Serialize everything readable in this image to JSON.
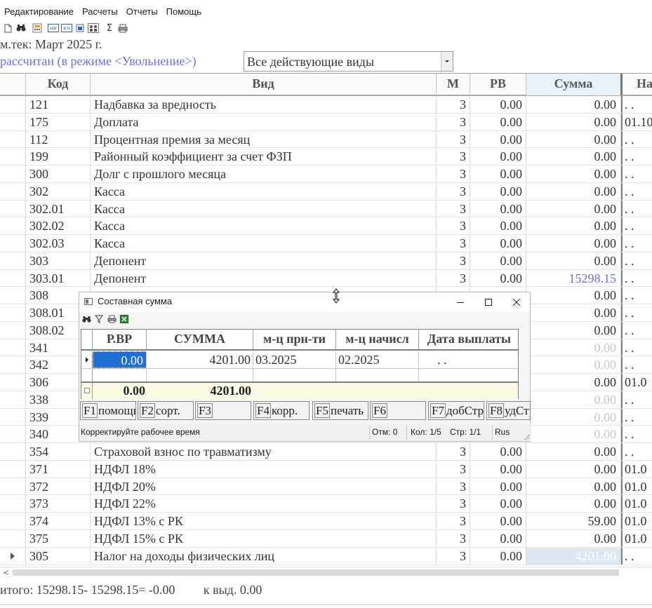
{
  "menu": [
    "Редактирование",
    "Расчеты",
    "Отчеты",
    "Помощь"
  ],
  "toolbar_icons": [
    "new-document-icon",
    "find-icon",
    "calculator-icon",
    "nu-icon",
    "kch-icon",
    "window-icon",
    "users-icon",
    "sigma-icon",
    "print-icon"
  ],
  "toolbar_labels": {
    "nu": "НУ",
    "kch": "КЧ",
    "sigma": "Σ"
  },
  "header": {
    "period": "м.тек: Март 2025 г.",
    "status": "рассчитан (в режиме <Увольнение>)",
    "filter_value": "Все действующие виды"
  },
  "grid": {
    "columns": [
      "Код",
      "Вид",
      "М",
      "РВ",
      "Сумма",
      "На"
    ],
    "rows": [
      {
        "code": "121",
        "vid": "Надбавка за вредность",
        "m": "3",
        "rv": "0.00",
        "sum": "0.00",
        "na": ". ."
      },
      {
        "code": "175",
        "vid": "Доплата",
        "m": "3",
        "rv": "0.00",
        "sum": "0.00",
        "na": "01.10"
      },
      {
        "code": "112",
        "vid": "Процентная премия за месяц",
        "m": "3",
        "rv": "0.00",
        "sum": "0.00",
        "na": ". ."
      },
      {
        "code": "199",
        "vid": "Районный коэффициент за счет ФЗП",
        "m": "3",
        "rv": "0.00",
        "sum": "0.00",
        "na": ". ."
      },
      {
        "code": "300",
        "vid": "Долг с прошлого месяца",
        "m": "3",
        "rv": "0.00",
        "sum": "0.00",
        "na": ". ."
      },
      {
        "code": "302",
        "vid": "Касса",
        "m": "3",
        "rv": "0.00",
        "sum": "0.00",
        "na": ". ."
      },
      {
        "code": "302.01",
        "vid": "Касса",
        "m": "3",
        "rv": "0.00",
        "sum": "0.00",
        "na": ". ."
      },
      {
        "code": "302.02",
        "vid": "Касса",
        "m": "3",
        "rv": "0.00",
        "sum": "0.00",
        "na": ". ."
      },
      {
        "code": "302.03",
        "vid": "Касса",
        "m": "3",
        "rv": "0.00",
        "sum": "0.00",
        "na": ". ."
      },
      {
        "code": "303",
        "vid": "Депонент",
        "m": "3",
        "rv": "0.00",
        "sum": "0.00",
        "na": ". ."
      },
      {
        "code": "303.01",
        "vid": "Депонент",
        "m": "3",
        "rv": "0.00",
        "sum": "15298.15",
        "na": ". .",
        "style": "blue"
      },
      {
        "code": "308",
        "vid": "",
        "m": "",
        "rv": "",
        "sum": "0.00",
        "na": ". ."
      },
      {
        "code": "308.01",
        "vid": "",
        "m": "",
        "rv": "",
        "sum": "0.00",
        "na": ". ."
      },
      {
        "code": "308.02",
        "vid": "",
        "m": "",
        "rv": "",
        "sum": "0.00",
        "na": ". ."
      },
      {
        "code": "341",
        "vid": "",
        "m": "",
        "rv": "",
        "sum": "0.00",
        "na": ". .",
        "style": "dim"
      },
      {
        "code": "342",
        "vid": "",
        "m": "",
        "rv": "",
        "sum": "0.00",
        "na": ". .",
        "style": "dim"
      },
      {
        "code": "306",
        "vid": "",
        "m": "",
        "rv": "",
        "sum": "0.00",
        "na": "01.0"
      },
      {
        "code": "338",
        "vid": "",
        "m": "",
        "rv": "",
        "sum": "0.00",
        "na": ". .",
        "style": "dim"
      },
      {
        "code": "339",
        "vid": "",
        "m": "",
        "rv": "",
        "sum": "0.00",
        "na": ". .",
        "style": "dim"
      },
      {
        "code": "340",
        "vid": "",
        "m": "",
        "rv": "",
        "sum": "0.00",
        "na": ". .",
        "style": "dim"
      },
      {
        "code": "354",
        "vid": "Страховой взнос по травматизму",
        "m": "3",
        "rv": "0.00",
        "sum": "0.00",
        "na": ". ."
      },
      {
        "code": "371",
        "vid": "НДФЛ 18%",
        "m": "3",
        "rv": "0.00",
        "sum": "0.00",
        "na": "01.0"
      },
      {
        "code": "372",
        "vid": "НДФЛ 20%",
        "m": "3",
        "rv": "0.00",
        "sum": "0.00",
        "na": "01.0"
      },
      {
        "code": "373",
        "vid": "НДФЛ 22%",
        "m": "3",
        "rv": "0.00",
        "sum": "0.00",
        "na": "01.0"
      },
      {
        "code": "374",
        "vid": "НДФЛ 13% с РК",
        "m": "3",
        "rv": "0.00",
        "sum": "59.00",
        "na": "01.0"
      },
      {
        "code": "375",
        "vid": "НДФЛ 15% с РК",
        "m": "3",
        "rv": "0.00",
        "sum": "0.00",
        "na": "01.0"
      },
      {
        "code": "305",
        "vid": "Налог на доходы физических лиц",
        "m": "3",
        "rv": "0.00",
        "sum": "4201.00",
        "na": ". .",
        "style": "sel",
        "current": true
      }
    ]
  },
  "totals": "итого: 15298.15- 15298.15= -0.00         к выд. 0.00",
  "dialog": {
    "title": "Составная сумма",
    "columns": [
      "Р.ВР",
      "СУММА",
      "м-ц прн-ти",
      "м-ц начисл",
      "Дата выплаты"
    ],
    "row": {
      "rvr": "0.00",
      "sum": "4201.00",
      "prn": "03.2025",
      "nach": "02.2025",
      "date": ". ."
    },
    "footer": {
      "rvr": "0.00",
      "sum": "4201.00"
    },
    "fkeys": [
      {
        "key": "F1",
        "label": "помощь"
      },
      {
        "key": "F2",
        "label": "сорт."
      },
      {
        "key": "F3",
        "label": ""
      },
      {
        "key": "F4",
        "label": "корр."
      },
      {
        "key": "F5",
        "label": "печать"
      },
      {
        "key": "F6",
        "label": ""
      },
      {
        "key": "F7",
        "label": "добСтр"
      },
      {
        "key": "F8",
        "label": "удСтр"
      }
    ],
    "status": {
      "message": "Корректируйте рабочее время",
      "marked": "Отм: 0",
      "col": "Кол: 1/5",
      "page": "Стр: 1/1",
      "lang": "Rus"
    }
  },
  "colors": {
    "blue_text": "#6e6ee0",
    "selection": "#1e6fd6",
    "sum_header": "#e8f2fb",
    "dialog_footer": "#fbfbe6"
  }
}
